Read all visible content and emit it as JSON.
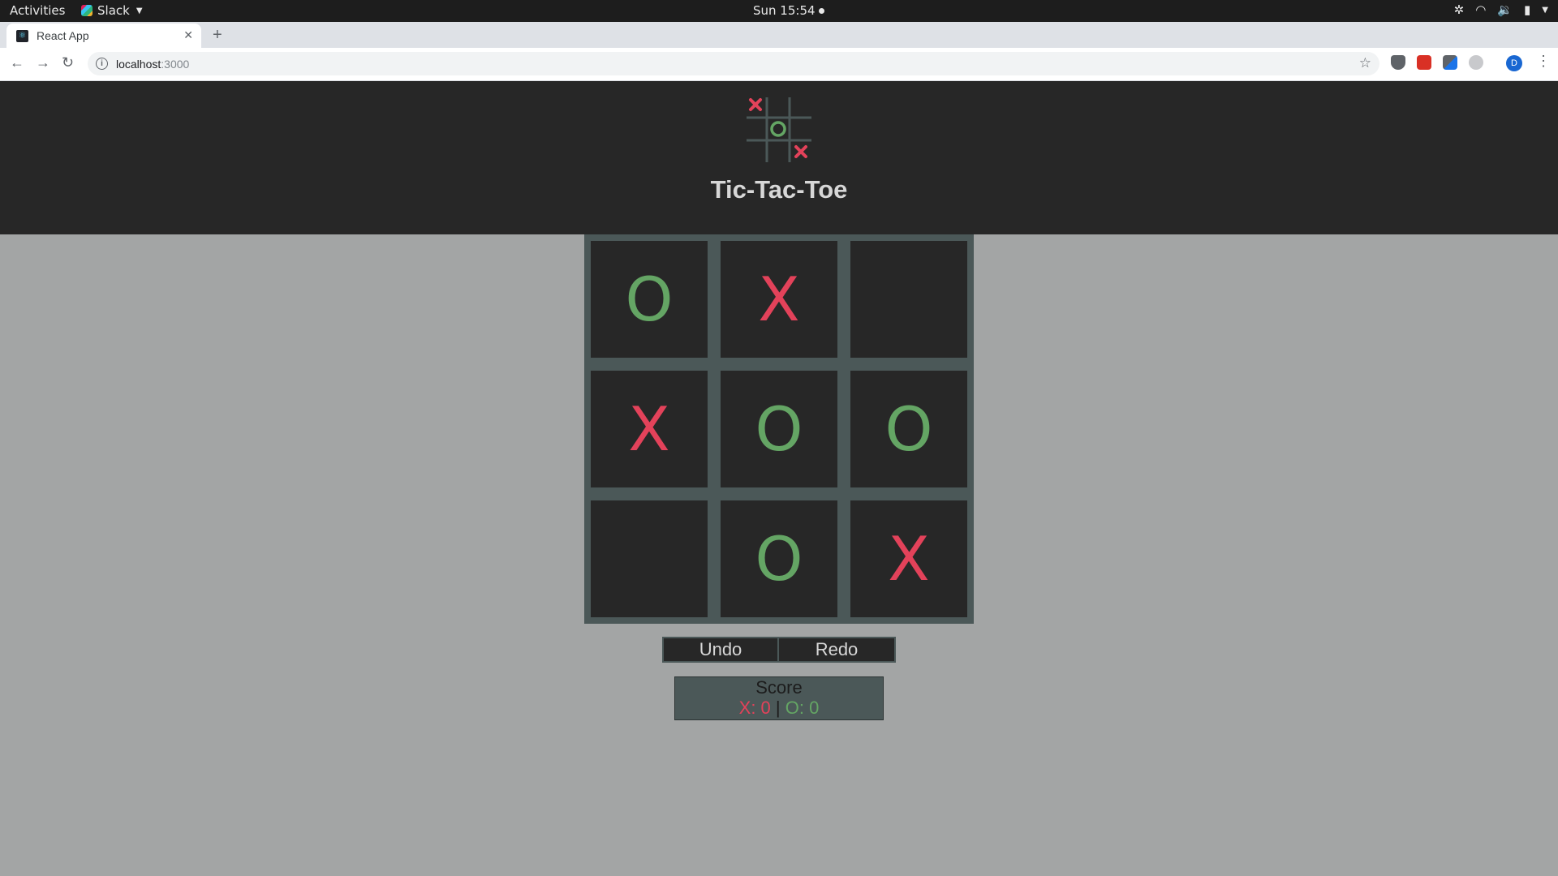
{
  "system_bar": {
    "activities": "Activities",
    "app_name": "Slack",
    "clock": "Sun 15:54"
  },
  "browser": {
    "tab_title": "React App",
    "url_host": "localhost",
    "url_port": ":3000"
  },
  "app": {
    "title": "Tic-Tac-Toe",
    "board": [
      [
        "O",
        "X",
        ""
      ],
      [
        "X",
        "O",
        "O"
      ],
      [
        "",
        "O",
        "X"
      ]
    ],
    "undo_label": "Undo",
    "redo_label": "Redo",
    "score": {
      "title": "Score",
      "x_label": "X: 0",
      "separator": "|",
      "o_label": "O: 0"
    }
  },
  "colors": {
    "x": "#e3425a",
    "o": "#64a564",
    "header_bg": "#272727",
    "page_bg": "#a3a5a5",
    "board_grid": "#4b5858"
  },
  "icons": [
    "wifi-icon",
    "volume-icon",
    "battery-icon",
    "settings-icon",
    "star-icon",
    "info-icon"
  ]
}
